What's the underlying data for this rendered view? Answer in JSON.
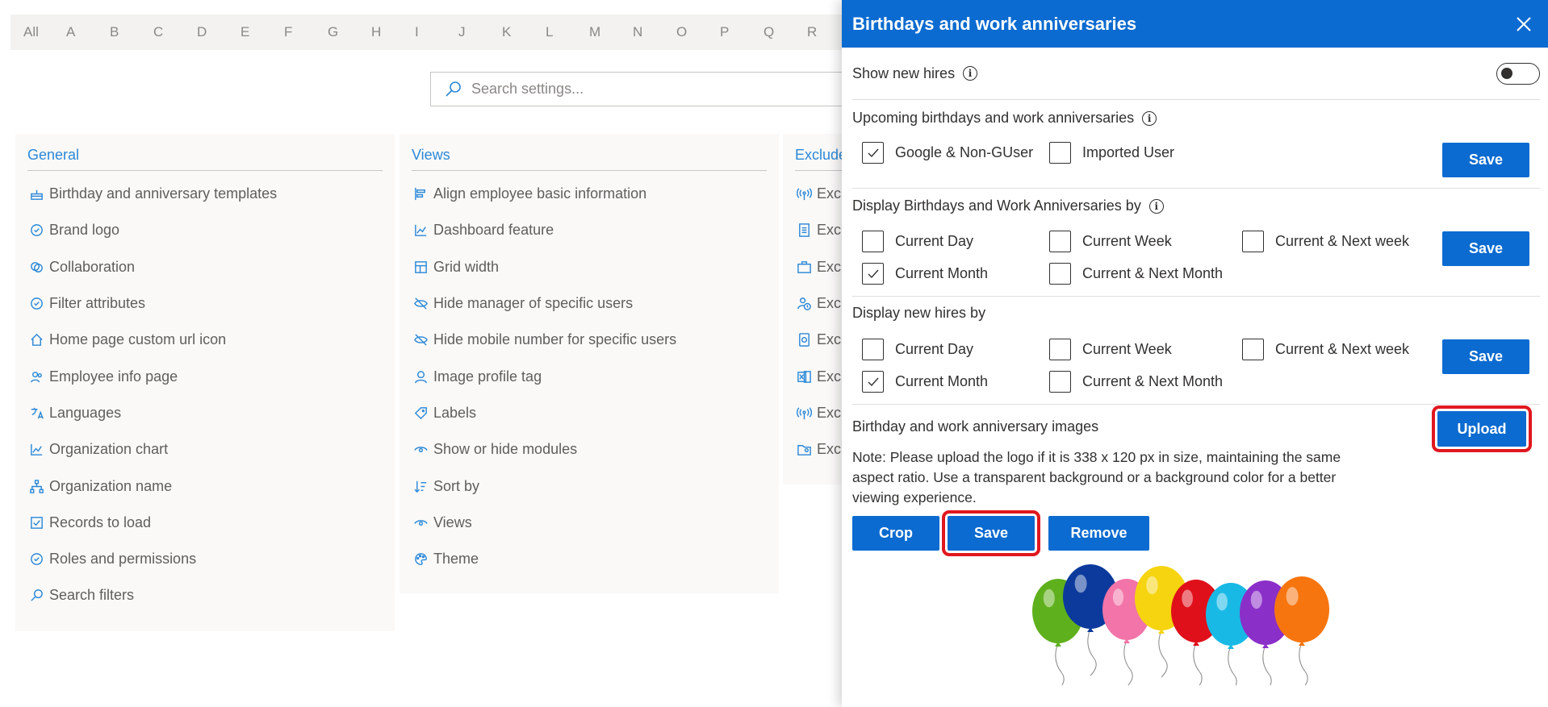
{
  "alphabet": [
    "All",
    "A",
    "B",
    "C",
    "D",
    "E",
    "F",
    "G",
    "H",
    "I",
    "J",
    "K",
    "L",
    "M",
    "N",
    "O",
    "P",
    "Q",
    "R"
  ],
  "search": {
    "placeholder": "Search settings..."
  },
  "columns": {
    "general": {
      "title": "General",
      "items": [
        {
          "label": "Birthday and anniversary templates",
          "icon": "cake-icon"
        },
        {
          "label": "Brand logo",
          "icon": "badge-icon"
        },
        {
          "label": "Collaboration",
          "icon": "collaboration-icon"
        },
        {
          "label": "Filter attributes",
          "icon": "badge-icon"
        },
        {
          "label": "Home page custom url icon",
          "icon": "home-icon"
        },
        {
          "label": "Employee info page",
          "icon": "people-icon"
        },
        {
          "label": "Languages",
          "icon": "language-icon"
        },
        {
          "label": "Organization chart",
          "icon": "chart-icon"
        },
        {
          "label": "Organization name",
          "icon": "org-icon"
        },
        {
          "label": "Records to load",
          "icon": "records-icon"
        },
        {
          "label": "Roles and permissions",
          "icon": "badge-icon"
        },
        {
          "label": "Search filters",
          "icon": "search-icon"
        }
      ]
    },
    "views": {
      "title": "Views",
      "items": [
        {
          "label": "Align employee basic information",
          "icon": "align-icon"
        },
        {
          "label": "Dashboard feature",
          "icon": "chart-icon"
        },
        {
          "label": "Grid width",
          "icon": "grid-icon"
        },
        {
          "label": "Hide manager of specific users",
          "icon": "eye-off-icon"
        },
        {
          "label": "Hide mobile number for specific users",
          "icon": "eye-off-icon"
        },
        {
          "label": "Image profile tag",
          "icon": "person-icon"
        },
        {
          "label": "Labels",
          "icon": "tag-icon"
        },
        {
          "label": "Show or hide modules",
          "icon": "eye-icon"
        },
        {
          "label": "Sort by",
          "icon": "sort-icon"
        },
        {
          "label": "Views",
          "icon": "eye-icon"
        },
        {
          "label": "Theme",
          "icon": "palette-icon"
        }
      ]
    },
    "exclude": {
      "title": "Exclude",
      "items": [
        {
          "label": "Exclu",
          "icon": "broadcast-icon"
        },
        {
          "label": "Exclu",
          "icon": "document-icon"
        },
        {
          "label": "Exclu",
          "icon": "briefcase-icon"
        },
        {
          "label": "Exclu",
          "icon": "person-clock-icon"
        },
        {
          "label": "Exclu",
          "icon": "phone-icon"
        },
        {
          "label": "Exclu",
          "icon": "excel-icon"
        },
        {
          "label": "Exclu",
          "icon": "broadcast-icon"
        },
        {
          "label": "Exclu",
          "icon": "folder-person-icon"
        }
      ]
    }
  },
  "panel": {
    "title": "Birthdays and work anniversaries",
    "show_new_hires": {
      "label": "Show new hires",
      "enabled": false
    },
    "upcoming": {
      "title": "Upcoming birthdays and work anniversaries",
      "options": [
        {
          "label": "Google & Non-GUser",
          "checked": true
        },
        {
          "label": "Imported User",
          "checked": false
        }
      ],
      "save_label": "Save"
    },
    "display_by": {
      "title": "Display Birthdays and Work Anniversaries by",
      "options": [
        {
          "label": "Current Day",
          "checked": false
        },
        {
          "label": "Current Week",
          "checked": false
        },
        {
          "label": "Current & Next week",
          "checked": false
        },
        {
          "label": "Current Month",
          "checked": true
        },
        {
          "label": "Current & Next Month",
          "checked": false
        }
      ],
      "save_label": "Save"
    },
    "new_hires_by": {
      "title": "Display new hires by",
      "options": [
        {
          "label": "Current Day",
          "checked": false
        },
        {
          "label": "Current Week",
          "checked": false
        },
        {
          "label": "Current & Next week",
          "checked": false
        },
        {
          "label": "Current Month",
          "checked": true
        },
        {
          "label": "Current & Next Month",
          "checked": false
        }
      ],
      "save_label": "Save"
    },
    "images": {
      "title": "Birthday and work anniversary images",
      "upload_label": "Upload",
      "note": "Note: Please upload the logo if it is 338 x 120 px in size, maintaining the same aspect ratio. Use a transparent background or a background color for a better viewing experience.",
      "crop_label": "Crop",
      "save_label": "Save",
      "remove_label": "Remove"
    }
  },
  "colors": {
    "primary": "#0b6bd0",
    "highlight": "#e0181f",
    "link": "#2b88d8",
    "balloons": [
      "#5fb01d",
      "#0c3a9c",
      "#f274a8",
      "#f6d40f",
      "#e0101b",
      "#19b9e6",
      "#8b2fc9",
      "#f7750f"
    ]
  }
}
